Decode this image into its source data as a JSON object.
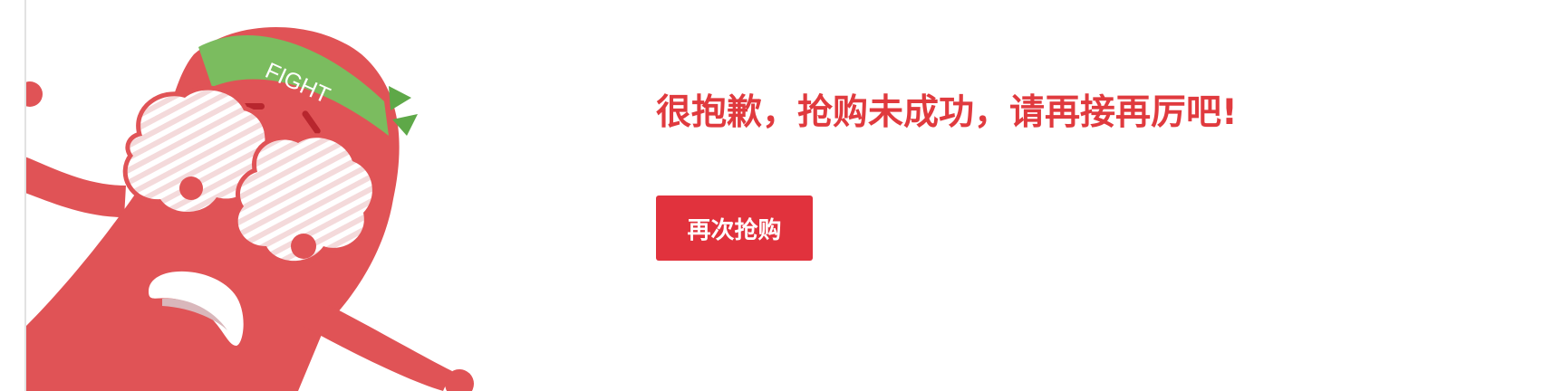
{
  "result": {
    "message": "很抱歉，抢购未成功，请再接再厉吧!",
    "retry_label": "再次抢购"
  },
  "mascot": {
    "headband_text": "FIGHT",
    "icon": "crying-mascot-fight-headband"
  },
  "colors": {
    "accent_red": "#e1323d",
    "message_red": "#e03a3e",
    "mascot_body": "#e05356",
    "headband_green": "#6bb85a"
  }
}
